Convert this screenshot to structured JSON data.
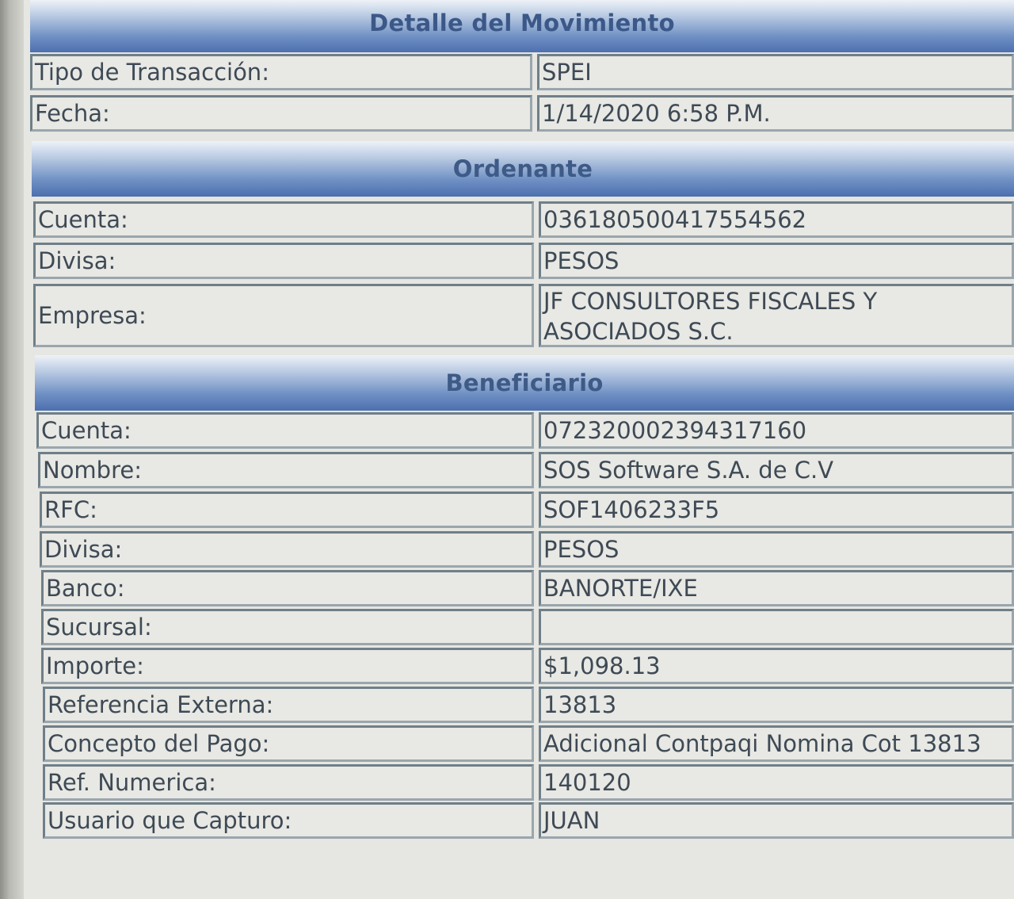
{
  "sections": {
    "detalle": "Detalle del Movimiento",
    "ordenante": "Ordenante",
    "beneficiario": "Beneficiario"
  },
  "detalle": [
    {
      "label": "Tipo de Transacción:",
      "value": "SPEI"
    },
    {
      "label": "Fecha:",
      "value": "1/14/2020 6:58 P.M."
    }
  ],
  "ordenante": [
    {
      "label": "Cuenta:",
      "value": "036180500417554562"
    },
    {
      "label": "Divisa:",
      "value": "PESOS"
    },
    {
      "label": "Empresa:",
      "value": "JF CONSULTORES FISCALES Y ASOCIADOS S.C."
    }
  ],
  "beneficiario": [
    {
      "label": "Cuenta:",
      "value": "072320002394317160"
    },
    {
      "label": "Nombre:",
      "value": "SOS Software S.A. de C.V"
    },
    {
      "label": "RFC:",
      "value": "SOF1406233F5"
    },
    {
      "label": "Divisa:",
      "value": "PESOS"
    },
    {
      "label": "Banco:",
      "value": "BANORTE/IXE"
    },
    {
      "label": "Sucursal:",
      "value": ""
    },
    {
      "label": "Importe:",
      "value": "$1,098.13"
    },
    {
      "label": "Referencia Externa:",
      "value": "13813"
    },
    {
      "label": "Concepto del Pago:",
      "value": "Adicional Contpaqi Nomina Cot 13813"
    },
    {
      "label": "Ref. Numerica:",
      "value": "140120"
    },
    {
      "label": "Usuario que Capturo:",
      "value": "JUAN"
    }
  ]
}
